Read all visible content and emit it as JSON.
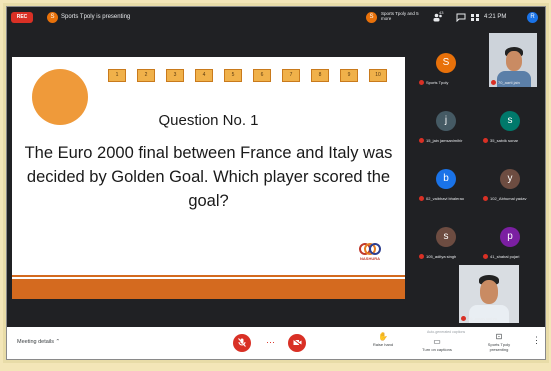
{
  "topbar": {
    "rec_label": "REC",
    "presenter_initial": "S",
    "presenting_text": "Sports Tpoly is presenting",
    "presenter_chip_initial": "S",
    "presenter_chip_text": "Sports Tpoly and 5 more",
    "participant_count": "43",
    "time": "4:21 PM",
    "me_initial": "R",
    "icons": [
      "people-icon",
      "chat-icon",
      "activities-icon"
    ]
  },
  "slide": {
    "numbers": [
      "1",
      "2",
      "3",
      "4",
      "5",
      "6",
      "7",
      "8",
      "9",
      "10"
    ],
    "question_title": "Question No. 1",
    "question_text": "The Euro 2000 final between France and Italy was decided by Golden Goal. Which player scored the goal?",
    "logo_brand": "NASHURA",
    "colors": {
      "accent": "#d46a1f",
      "timer": "#ef9a3a",
      "box": "#f0b14a"
    }
  },
  "participants": [
    {
      "initial": "S",
      "name": "Sports Tpoly",
      "color": "#e8710a"
    },
    {
      "initial": "",
      "name": "70_aarti jain",
      "camera": true
    },
    {
      "initial": "j",
      "name": "15_jain jamsanimihir",
      "color": "#455a64"
    },
    {
      "initial": "s",
      "name": "35_satvik sonar",
      "color": "#00796b"
    },
    {
      "initial": "b",
      "name": "02_vaibhavi bhalerao",
      "color": "#1a73e8"
    },
    {
      "initial": "y",
      "name": "102_Abhumal yadav",
      "color": "#6d4c41"
    },
    {
      "initial": "s",
      "name": "105_aditya singh",
      "color": "#6d4c41"
    },
    {
      "initial": "p",
      "name": "41_shabal pujari",
      "color": "#7b1fa2"
    },
    {
      "initial": "",
      "name": "26_aman mehra",
      "camera": true
    }
  ],
  "bottombar": {
    "meeting_details": "Meeting details",
    "raise_hand": "Raise hand",
    "captions": "Turn on captions",
    "captions_note": "Auto-generated captions",
    "presenting": "Sports Tpoly presenting"
  }
}
